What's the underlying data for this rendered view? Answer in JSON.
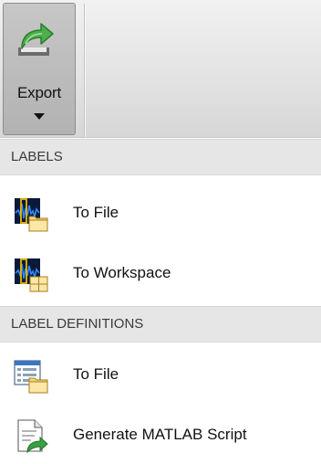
{
  "toolstrip": {
    "export_button": {
      "label": "Export",
      "icon": "export-icon"
    }
  },
  "menu": {
    "sections": [
      {
        "header": "LABELS",
        "items": [
          {
            "label": "To File",
            "icon": "signal-labels-file-icon"
          },
          {
            "label": "To Workspace",
            "icon": "signal-labels-workspace-icon"
          }
        ]
      },
      {
        "header": "LABEL DEFINITIONS",
        "items": [
          {
            "label": "To File",
            "icon": "definitions-file-icon"
          },
          {
            "label": "Generate MATLAB Script",
            "icon": "generate-script-icon"
          }
        ]
      }
    ]
  },
  "colors": {
    "section_header_bg": "#e6e6e6",
    "export_button_bg": "#b8b8b8",
    "signal_plot_bg": "#0b1a3a",
    "signal_trace": "#2f8bff",
    "highlight_box": "#e6b800",
    "folder_yellow": "#f6d77a",
    "arrow_green": "#3aa046"
  }
}
